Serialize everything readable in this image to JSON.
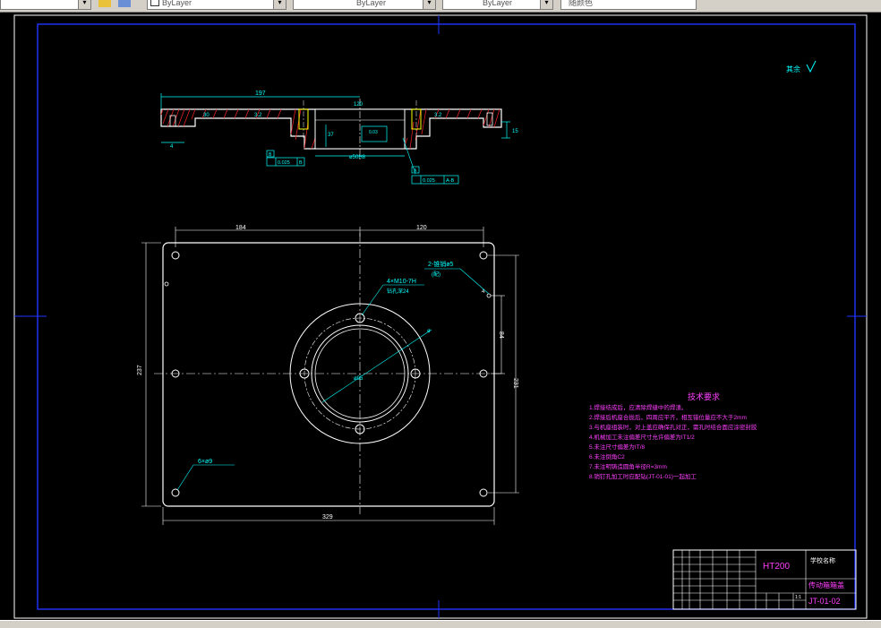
{
  "toolbar": {
    "color_combo": "ByLayer",
    "linetype_combo": "ByLayer",
    "lineweight_combo": "ByLayer",
    "plotstyle_combo": "随颜色"
  },
  "top_view": {
    "dim_197": "197",
    "dim_30": "30",
    "dim_120": "120",
    "dim_4_left": "4",
    "dim_15": "15",
    "dim_37": "37",
    "bore_label": "ø50H8",
    "fcf_left": "0.025",
    "fcf_left_datum": "B",
    "fcf_center": "0.03",
    "fcf_right": "0.025",
    "fcf_right_datum": "A-B",
    "datum_a": "A",
    "datum_b": "B",
    "rough_left": "3.2",
    "rough_right": "3.2"
  },
  "plan_view": {
    "dim_top_left": "184",
    "dim_top_right": "120",
    "dim_bottom": "329",
    "dim_left_height": "237",
    "dim_right_outer": "231",
    "dim_right_inner": "84",
    "hole_note_top_right": "2-锥销ø5",
    "hole_note_top_right_sub": "(配)",
    "tapped_note": "4×M10-7H",
    "tapped_note_sub": "钻孔深24",
    "dia_big": "ø",
    "dia_small": "ø95",
    "clearance_note": "6×ø9",
    "dim_4_side": "4"
  },
  "tech_req": {
    "title": "技术要求",
    "items": [
      "1.焊接结成后，应清除焊缝中的焊渣。",
      "2.焊接后机座合拢后，四周应平齐，相互错位量应不大于2mm",
      "3.与机座组装时，对上盖应确保孔对正，需孔时结合面应涂密封胶",
      "4.机械加工未注偏差尺寸允许偏差为IT1/2",
      "5.未注尺寸偏差为IT/8",
      "6.未注倒角C2",
      "7.未注明铸造圆角半径R=3mm",
      "8.销钉孔加工时应配钻(JT-01-01)一起加工"
    ]
  },
  "surface_mark": "其余",
  "title_block": {
    "material": "HT200",
    "school": "学校名称",
    "part_name": "传动箱箱盖",
    "drawing_no": "JT-01-02",
    "scale": "1:1"
  }
}
